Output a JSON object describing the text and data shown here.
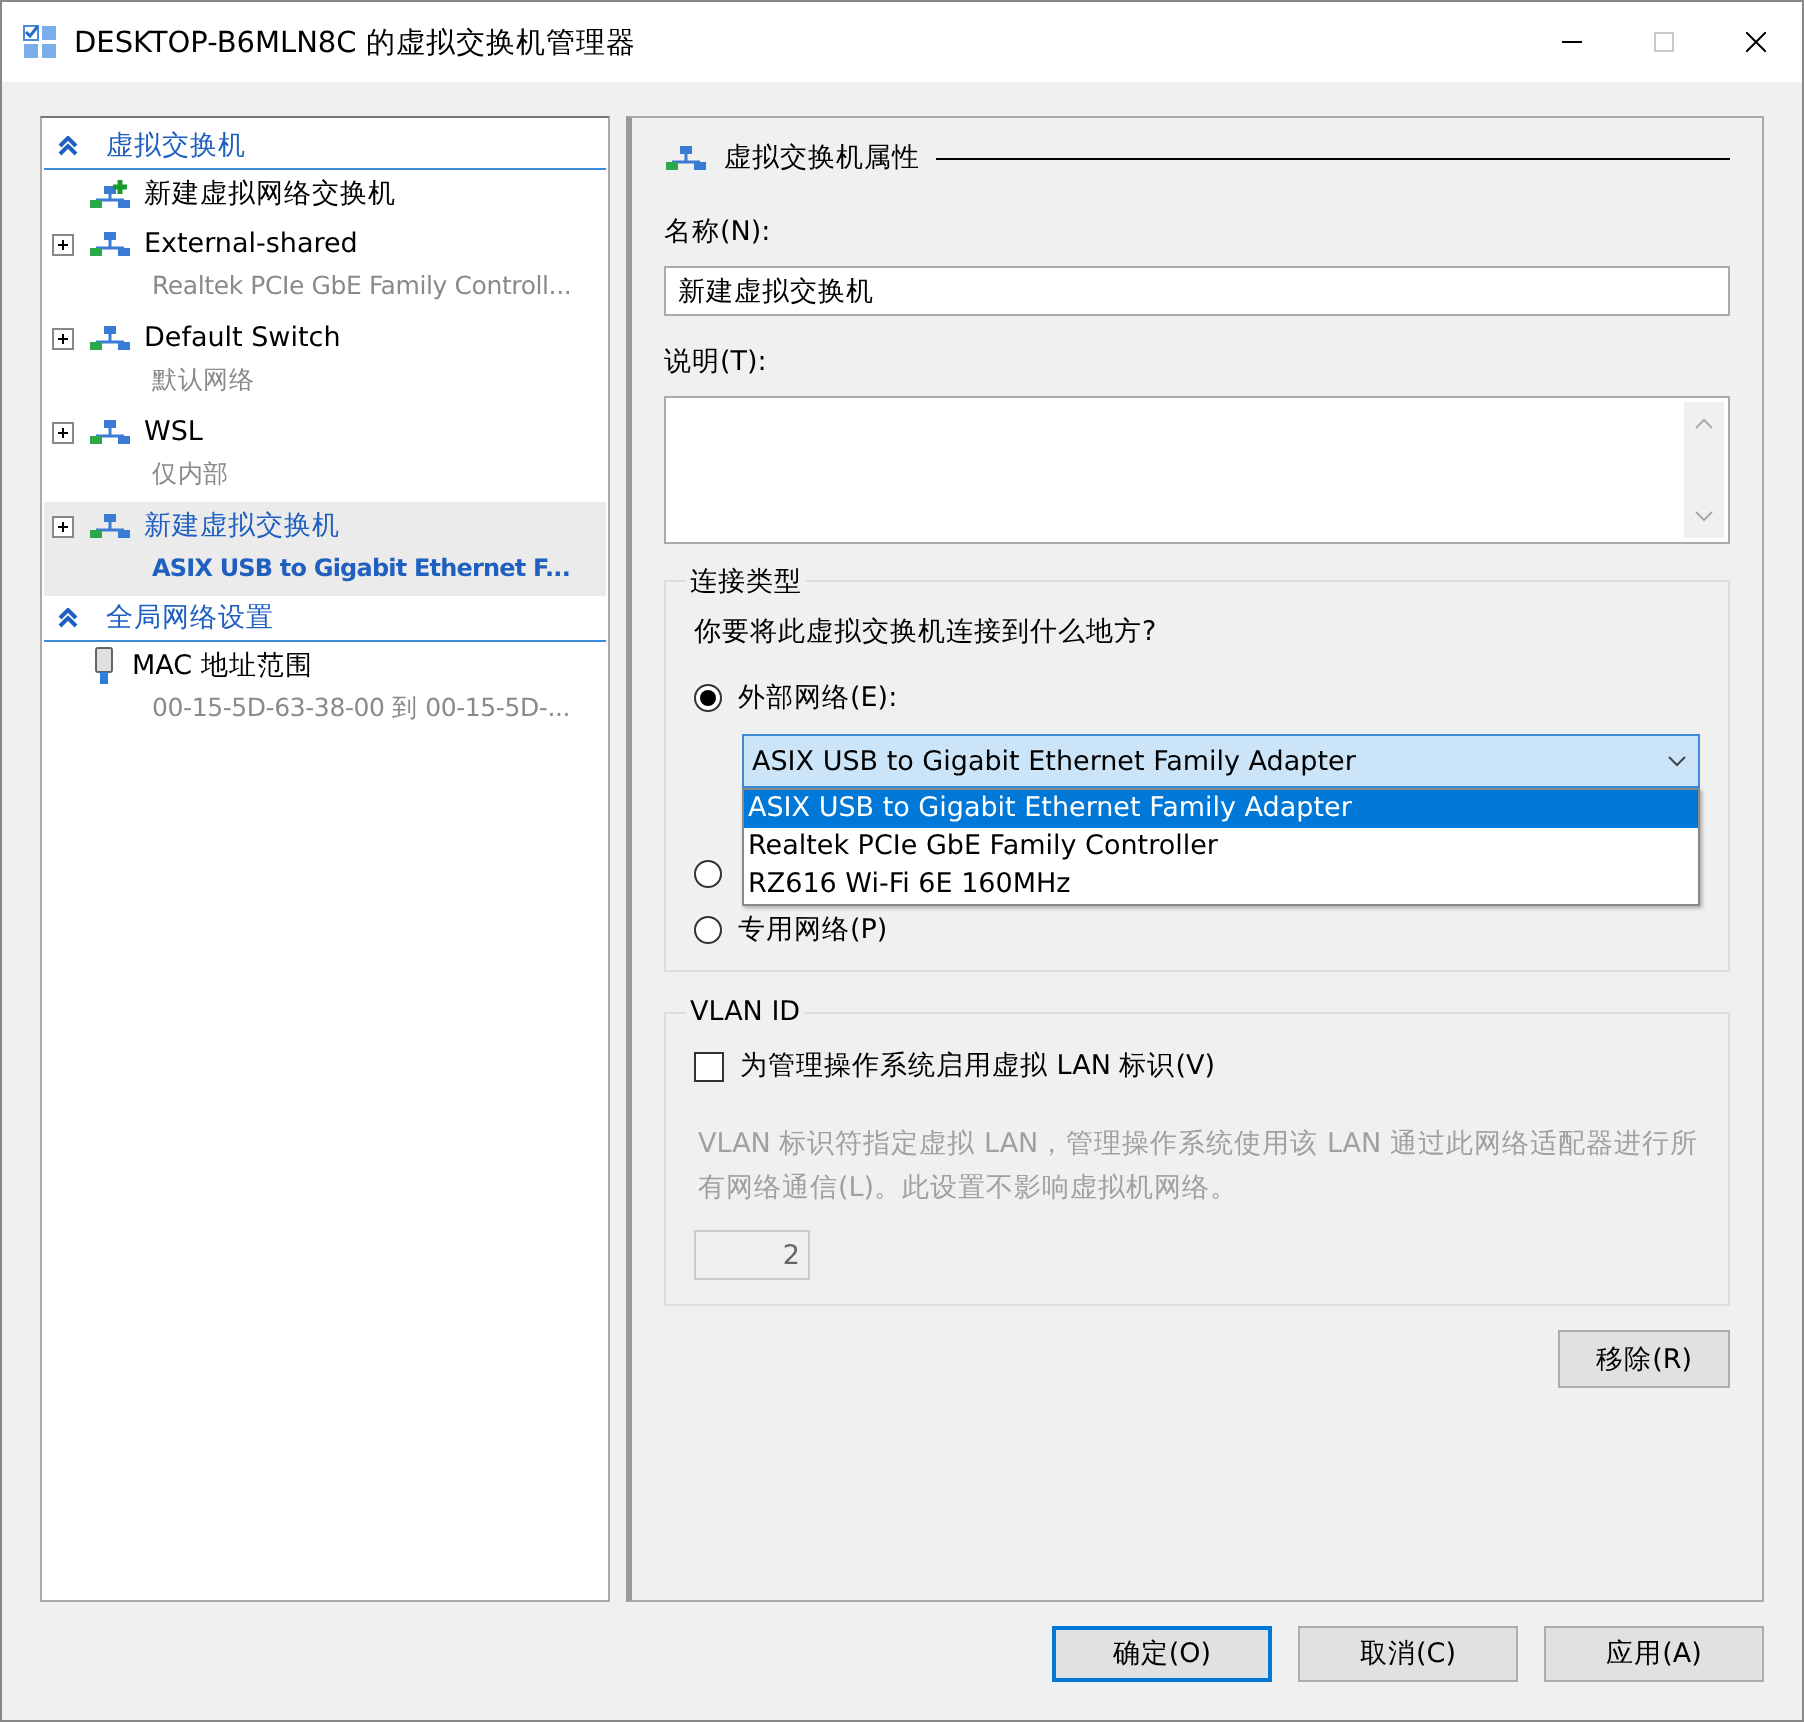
{
  "window": {
    "title": "DESKTOP-B6MLN8C 的虚拟交换机管理器",
    "maximize_disabled": true
  },
  "sidebar": {
    "sections": [
      {
        "title": "虚拟交换机",
        "expanded": true,
        "items": [
          {
            "kind": "add",
            "name": "新建虚拟网络交换机",
            "expandable": false,
            "selected": false
          },
          {
            "kind": "switch",
            "name": "External-shared",
            "detail": "Realtek PCIe GbE Family Controll...",
            "expandable": true,
            "selected": false
          },
          {
            "kind": "switch",
            "name": "Default Switch",
            "detail": "默认网络",
            "expandable": true,
            "selected": false
          },
          {
            "kind": "switch",
            "name": "WSL",
            "detail": "仅内部",
            "expandable": true,
            "selected": false
          },
          {
            "kind": "switch",
            "name": "新建虚拟交换机",
            "detail": "ASIX USB to Gigabit Ethernet F...",
            "expandable": true,
            "selected": true
          }
        ]
      },
      {
        "title": "全局网络设置",
        "expanded": true,
        "items": [
          {
            "kind": "mac",
            "name": "MAC 地址范围",
            "detail": "00-15-5D-63-38-00 到 00-15-5D-...",
            "expandable": false,
            "selected": false
          }
        ]
      }
    ]
  },
  "properties": {
    "header": "虚拟交换机属性",
    "name_label": "名称(N):",
    "name_value": "新建虚拟交换机",
    "description_label": "说明(T):",
    "connection": {
      "legend": "连接类型",
      "question": "你要将此虚拟交换机连接到什么地方?",
      "options": [
        {
          "label": "外部网络(E):",
          "selected": true
        },
        {
          "selected": false
        },
        {
          "label": "专用网络(P)",
          "selected": false
        }
      ],
      "adapter": {
        "value": "ASIX USB to Gigabit Ethernet Family Adapter",
        "expanded": true,
        "options": [
          {
            "label": "ASIX USB to Gigabit Ethernet Family Adapter",
            "selected": true
          },
          {
            "label": "Realtek PCIe GbE Family Controller",
            "selected": false
          },
          {
            "label": "RZ616 Wi-Fi 6E 160MHz",
            "selected": false
          }
        ]
      }
    },
    "vlan": {
      "legend": "VLAN ID",
      "checkbox": {
        "label": "为管理操作系统启用虚拟 LAN 标识(V)",
        "checked": false
      },
      "description": "VLAN 标识符指定虚拟 LAN，管理操作系统使用该 LAN 通过此网络适配器进行所有网络通信(L)。此设置不影响虚拟机网络。",
      "value": "2",
      "disabled": true
    },
    "remove_button": "移除(R)"
  },
  "buttons": [
    {
      "label": "确定(O)",
      "default": true
    },
    {
      "label": "取消(C)",
      "default": false
    },
    {
      "label": "应用(A)",
      "default": false
    }
  ]
}
